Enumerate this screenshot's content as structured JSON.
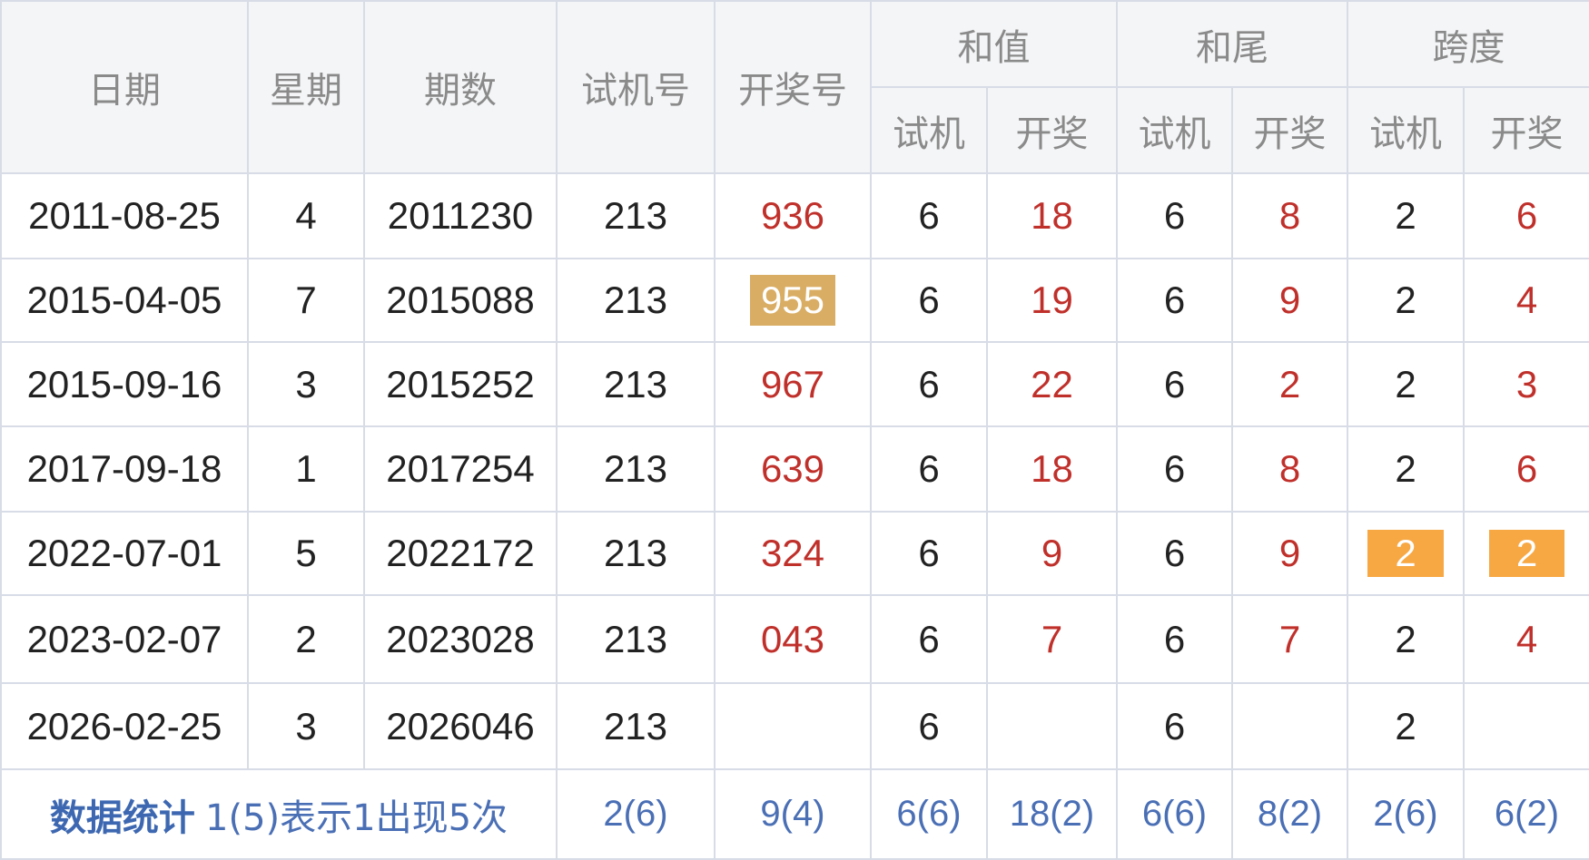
{
  "header": {
    "date": "日期",
    "weekday": "星期",
    "issue": "期数",
    "trial_number": "试机号",
    "draw_number": "开奖号",
    "sum": "和值",
    "sum_tail": "和尾",
    "span": "跨度",
    "sub_trial": "试机",
    "sub_draw": "开奖"
  },
  "rows": [
    {
      "date": "2011-08-25",
      "weekday": "4",
      "issue": "2011230",
      "trial": "213",
      "draw": "936",
      "sum_trial": "6",
      "sum_draw": "18",
      "tail_trial": "6",
      "tail_draw": "8",
      "span_trial": "2",
      "span_draw": "6"
    },
    {
      "date": "2015-04-05",
      "weekday": "7",
      "issue": "2015088",
      "trial": "213",
      "draw": "955",
      "sum_trial": "6",
      "sum_draw": "19",
      "tail_trial": "6",
      "tail_draw": "9",
      "span_trial": "2",
      "span_draw": "4"
    },
    {
      "date": "2015-09-16",
      "weekday": "3",
      "issue": "2015252",
      "trial": "213",
      "draw": "967",
      "sum_trial": "6",
      "sum_draw": "22",
      "tail_trial": "6",
      "tail_draw": "2",
      "span_trial": "2",
      "span_draw": "3"
    },
    {
      "date": "2017-09-18",
      "weekday": "1",
      "issue": "2017254",
      "trial": "213",
      "draw": "639",
      "sum_trial": "6",
      "sum_draw": "18",
      "tail_trial": "6",
      "tail_draw": "8",
      "span_trial": "2",
      "span_draw": "6"
    },
    {
      "date": "2022-07-01",
      "weekday": "5",
      "issue": "2022172",
      "trial": "213",
      "draw": "324",
      "sum_trial": "6",
      "sum_draw": "9",
      "tail_trial": "6",
      "tail_draw": "9",
      "span_trial": "2",
      "span_draw": "2"
    },
    {
      "date": "2023-02-07",
      "weekday": "2",
      "issue": "2023028",
      "trial": "213",
      "draw": "043",
      "sum_trial": "6",
      "sum_draw": "7",
      "tail_trial": "6",
      "tail_draw": "7",
      "span_trial": "2",
      "span_draw": "4"
    },
    {
      "date": "2026-02-25",
      "weekday": "3",
      "issue": "2026046",
      "trial": "213",
      "draw": "",
      "sum_trial": "6",
      "sum_draw": "",
      "tail_trial": "6",
      "tail_draw": "",
      "span_trial": "2",
      "span_draw": ""
    }
  ],
  "stats": {
    "title": "数据统计",
    "desc": "1(5)表示1出现5次",
    "trial": "2(6)",
    "draw": "9(4)",
    "sum_trial": "6(6)",
    "sum_draw": "18(2)",
    "tail_trial": "6(6)",
    "tail_draw": "8(2)",
    "span_trial": "2(6)",
    "span_draw": "6(2)"
  },
  "colors": {
    "draw_red": "#c0302b",
    "highlight_gold": "#d9ad63",
    "highlight_orange": "#f7a843",
    "stats_blue": "#4a6fb5",
    "header_bg": "#f4f5f7",
    "grid": "#d7dce6"
  }
}
